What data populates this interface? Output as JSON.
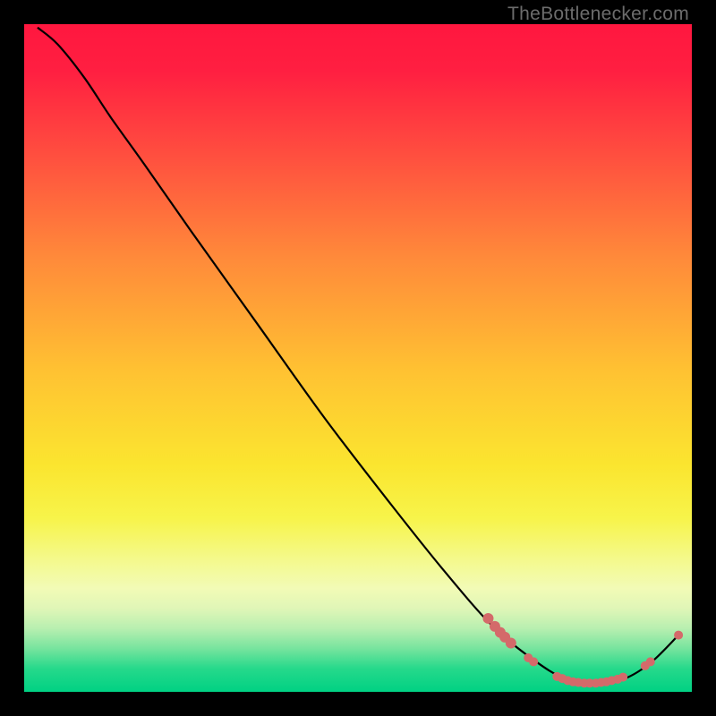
{
  "watermark": "TheBottleneсker.com",
  "chart_data": {
    "type": "line",
    "title": "",
    "xlabel": "",
    "ylabel": "",
    "xlim": [
      0,
      100
    ],
    "ylim": [
      0,
      100
    ],
    "background_gradient": {
      "stops": [
        {
          "offset": 0.0,
          "color": "#ff173f"
        },
        {
          "offset": 0.07,
          "color": "#ff1f41"
        },
        {
          "offset": 0.2,
          "color": "#ff503f"
        },
        {
          "offset": 0.35,
          "color": "#ff8a3a"
        },
        {
          "offset": 0.52,
          "color": "#ffc232"
        },
        {
          "offset": 0.66,
          "color": "#fbe52f"
        },
        {
          "offset": 0.74,
          "color": "#f7f44a"
        },
        {
          "offset": 0.8,
          "color": "#f4f98a"
        },
        {
          "offset": 0.845,
          "color": "#f2fbb6"
        },
        {
          "offset": 0.875,
          "color": "#e0f6b7"
        },
        {
          "offset": 0.905,
          "color": "#b8efb0"
        },
        {
          "offset": 0.935,
          "color": "#77e49e"
        },
        {
          "offset": 0.965,
          "color": "#26d98b"
        },
        {
          "offset": 1.0,
          "color": "#00d183"
        }
      ]
    },
    "series": [
      {
        "name": "curve",
        "color": "#000000",
        "values": [
          {
            "x": 2.0,
            "y": 99.5
          },
          {
            "x": 5.0,
            "y": 97.0
          },
          {
            "x": 9.0,
            "y": 92.0
          },
          {
            "x": 13.0,
            "y": 86.0
          },
          {
            "x": 18.0,
            "y": 79.0
          },
          {
            "x": 25.0,
            "y": 69.0
          },
          {
            "x": 35.0,
            "y": 55.0
          },
          {
            "x": 45.0,
            "y": 41.0
          },
          {
            "x": 55.0,
            "y": 28.0
          },
          {
            "x": 63.0,
            "y": 18.0
          },
          {
            "x": 70.0,
            "y": 10.0
          },
          {
            "x": 76.0,
            "y": 5.0
          },
          {
            "x": 81.0,
            "y": 2.0
          },
          {
            "x": 86.0,
            "y": 1.3
          },
          {
            "x": 90.0,
            "y": 2.0
          },
          {
            "x": 94.0,
            "y": 4.5
          },
          {
            "x": 98.0,
            "y": 8.5
          }
        ]
      }
    ],
    "markers": {
      "color": "#d46a6a",
      "points": [
        {
          "x": 69.5,
          "y": 11.0,
          "r": 6
        },
        {
          "x": 70.5,
          "y": 9.8,
          "r": 6
        },
        {
          "x": 71.3,
          "y": 8.9,
          "r": 6
        },
        {
          "x": 72.0,
          "y": 8.2,
          "r": 6
        },
        {
          "x": 72.9,
          "y": 7.3,
          "r": 6
        },
        {
          "x": 75.5,
          "y": 5.1,
          "r": 5
        },
        {
          "x": 76.3,
          "y": 4.5,
          "r": 5
        },
        {
          "x": 79.8,
          "y": 2.3,
          "r": 5
        },
        {
          "x": 80.6,
          "y": 2.0,
          "r": 5
        },
        {
          "x": 81.4,
          "y": 1.7,
          "r": 5
        },
        {
          "x": 82.2,
          "y": 1.5,
          "r": 5
        },
        {
          "x": 83.0,
          "y": 1.4,
          "r": 5
        },
        {
          "x": 83.9,
          "y": 1.3,
          "r": 5
        },
        {
          "x": 84.7,
          "y": 1.3,
          "r": 5
        },
        {
          "x": 85.6,
          "y": 1.3,
          "r": 5
        },
        {
          "x": 86.4,
          "y": 1.4,
          "r": 5
        },
        {
          "x": 87.2,
          "y": 1.5,
          "r": 5
        },
        {
          "x": 88.0,
          "y": 1.7,
          "r": 5
        },
        {
          "x": 88.9,
          "y": 1.9,
          "r": 5
        },
        {
          "x": 89.7,
          "y": 2.2,
          "r": 5
        },
        {
          "x": 93.0,
          "y": 3.9,
          "r": 5
        },
        {
          "x": 93.8,
          "y": 4.5,
          "r": 5
        },
        {
          "x": 98.0,
          "y": 8.5,
          "r": 5
        }
      ]
    }
  }
}
